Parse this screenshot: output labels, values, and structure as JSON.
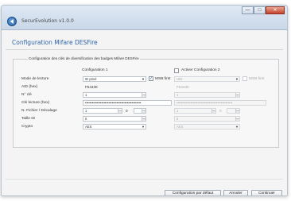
{
  "window": {
    "title": "SecurEvolution v1.0.0",
    "min": "—",
    "max": "□",
    "close": "✕"
  },
  "page": {
    "title": "Configuration Mifare DESFire",
    "group_legend": "Configuration des clés de diversification des badges Mifare DESFire"
  },
  "columns": {
    "config1": "Configuration 1",
    "config2_label": "Activer Configuration 2",
    "config2_checked": false
  },
  "rows": {
    "mode_lecture": {
      "label": "Mode de lecture",
      "c1": "ID privé",
      "c1_msb": "MSB first",
      "c1_msb_checked": true,
      "c2": "UID",
      "c2_msb": "MSB first",
      "c2_msb_checked": false
    },
    "aid": {
      "label": "AID (hex)",
      "c1": "F54430",
      "c2": "F54430"
    },
    "no_cle": {
      "label": "N° clé",
      "c1": "1",
      "c2": "1"
    },
    "cle_lecture": {
      "label": "Clé lecture (hex)",
      "c1": "••••••••••••••••••••••••••••••••••••••••••••••••",
      "c2": "••••••••••••••••••••••••••••••••••••••••••••••••"
    },
    "fichier": {
      "label": "N. Fichier / Décalage",
      "c1_a": "1",
      "c1_sep": "0",
      "c2_a": "1",
      "c2_sep": "0"
    },
    "taille": {
      "label": "Taille ID",
      "c1": "5",
      "c2": "5"
    },
    "crypto": {
      "label": "Crypto",
      "c1": "AES",
      "c2": "AES"
    }
  },
  "buttons": {
    "default": "Configuration par défaut",
    "cancel": "Annuler",
    "continue": "Continuer"
  },
  "icons": {
    "back": "back-arrow-icon"
  }
}
